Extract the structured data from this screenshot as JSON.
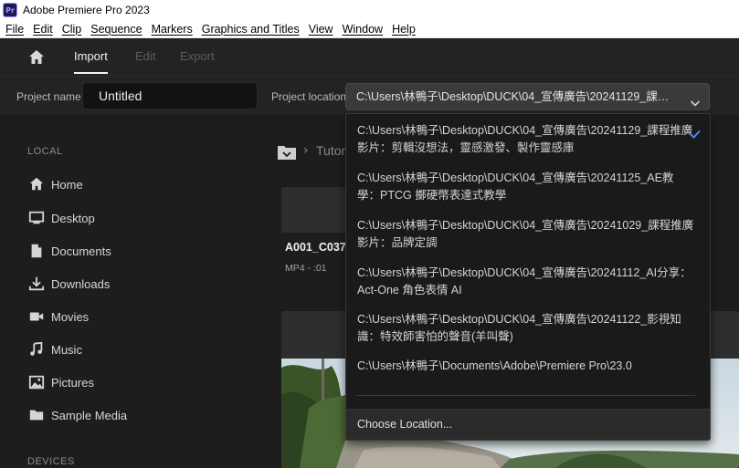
{
  "window": {
    "title": "Adobe Premiere Pro 2023",
    "app_icon_text": "Pr"
  },
  "menu": [
    "File",
    "Edit",
    "Clip",
    "Sequence",
    "Markers",
    "Graphics and Titles",
    "View",
    "Window",
    "Help"
  ],
  "topnav": {
    "tabs": [
      "Import",
      "Edit",
      "Export"
    ],
    "active": "Import"
  },
  "project": {
    "name_label": "Project name",
    "name_value": "Untitled",
    "location_label": "Project location",
    "location_value": "C:\\Users\\林鴨子\\Desktop\\DUCK\\04_宣傳廣告\\20241129_課程推廣影片：剪輯沒想法，靈感激發、製作靈感庫"
  },
  "sidebar": {
    "local_heading": "LOCAL",
    "items": [
      {
        "label": "Home",
        "icon": "home-icon"
      },
      {
        "label": "Desktop",
        "icon": "monitor-icon"
      },
      {
        "label": "Documents",
        "icon": "document-icon"
      },
      {
        "label": "Downloads",
        "icon": "download-icon"
      },
      {
        "label": "Movies",
        "icon": "video-camera-icon"
      },
      {
        "label": "Music",
        "icon": "music-note-icon"
      },
      {
        "label": "Pictures",
        "icon": "image-icon"
      },
      {
        "label": "Sample Media",
        "icon": "folder-icon"
      }
    ],
    "devices_heading": "DEVICES"
  },
  "browser": {
    "breadcrumb": "Tutor",
    "clip_name": "A001_C037_",
    "clip_meta": "MP4 - :01"
  },
  "dropdown": {
    "items": [
      "C:\\Users\\林鴨子\\Desktop\\DUCK\\04_宣傳廣告\\20241129_課程推廣影片：剪輯沒想法，靈感激發、製作靈感庫",
      "C:\\Users\\林鴨子\\Desktop\\DUCK\\04_宣傳廣告\\20241125_AE教學：PTCG 擲硬幣表達式教學",
      "C:\\Users\\林鴨子\\Desktop\\DUCK\\04_宣傳廣告\\20241029_課程推廣影片：品牌定調",
      "C:\\Users\\林鴨子\\Desktop\\DUCK\\04_宣傳廣告\\20241112_AI分享：Act-One 角色表情 AI",
      "C:\\Users\\林鴨子\\Desktop\\DUCK\\04_宣傳廣告\\20241122_影視知識：特效師害怕的聲音(羊叫聲)",
      "C:\\Users\\林鴨子\\Documents\\Adobe\\Premiere Pro\\23.0"
    ],
    "selected_index": 0,
    "choose_label": "Choose Location..."
  },
  "colors": {
    "accent_check": "#3b8cff",
    "background": "#1d1d1d",
    "panel": "#232323"
  }
}
